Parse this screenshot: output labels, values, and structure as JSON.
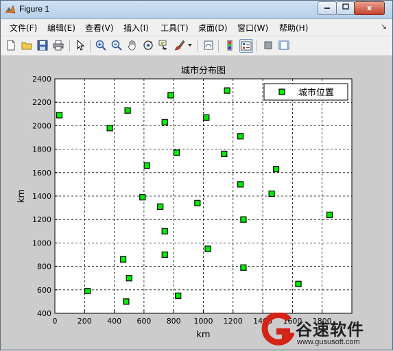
{
  "window": {
    "title": "Figure 1",
    "close_label": "x"
  },
  "menu": [
    "文件(F)",
    "编辑(E)",
    "查看(V)",
    "插入(I)",
    "工具(T)",
    "桌面(D)",
    "窗口(W)",
    "帮助(H)"
  ],
  "toolbar": {
    "icons": [
      "new-figure-icon",
      "open-file-icon",
      "save-icon",
      "print-icon",
      "select-arrow-icon",
      "zoom-in-icon",
      "zoom-out-icon",
      "pan-hand-icon",
      "rotate-3d-icon",
      "data-cursor-icon",
      "brush-icon",
      "link-plot-icon",
      "colorbar-icon",
      "legend-icon",
      "hide-plot-tools-icon",
      "show-plot-tools-icon"
    ]
  },
  "chart_data": {
    "type": "scatter",
    "title": "城市分布图",
    "xlabel": "km",
    "ylabel": "km",
    "xlim": [
      0,
      2000
    ],
    "ylim": [
      400,
      2400
    ],
    "xticks": [
      "0",
      "200",
      "400",
      "600",
      "800",
      "1000",
      "1200",
      "1400",
      "1600",
      "1800",
      ""
    ],
    "yticks": [
      "400",
      "600",
      "800",
      "1000",
      "1200",
      "1400",
      "1600",
      "1800",
      "2000",
      "2200",
      "2400"
    ],
    "grid": true,
    "legend_position": "top-right",
    "series": [
      {
        "name": "城市位置",
        "marker": "square",
        "color": "#00ee00",
        "edge_color": "#000000",
        "points": [
          [
            30,
            2090
          ],
          [
            490,
            2130
          ],
          [
            780,
            2260
          ],
          [
            1160,
            2300
          ],
          [
            370,
            1980
          ],
          [
            740,
            2030
          ],
          [
            1020,
            2070
          ],
          [
            1250,
            1910
          ],
          [
            820,
            1770
          ],
          [
            1140,
            1760
          ],
          [
            620,
            1660
          ],
          [
            1490,
            1630
          ],
          [
            1250,
            1500
          ],
          [
            1460,
            1420
          ],
          [
            590,
            1390
          ],
          [
            960,
            1340
          ],
          [
            710,
            1310
          ],
          [
            1270,
            1200
          ],
          [
            1850,
            1240
          ],
          [
            740,
            1100
          ],
          [
            1030,
            950
          ],
          [
            460,
            860
          ],
          [
            740,
            900
          ],
          [
            1270,
            790
          ],
          [
            500,
            700
          ],
          [
            220,
            590
          ],
          [
            1640,
            650
          ],
          [
            830,
            550
          ],
          [
            480,
            500
          ]
        ]
      }
    ]
  },
  "watermark": {
    "brand": "谷速软件",
    "url": "www.gususoft.com"
  },
  "colors": {
    "titlebar": "#c4d9ef",
    "close_button": "#c4432c",
    "marker": "#00ee00",
    "figure_bg": "#cccccc"
  }
}
